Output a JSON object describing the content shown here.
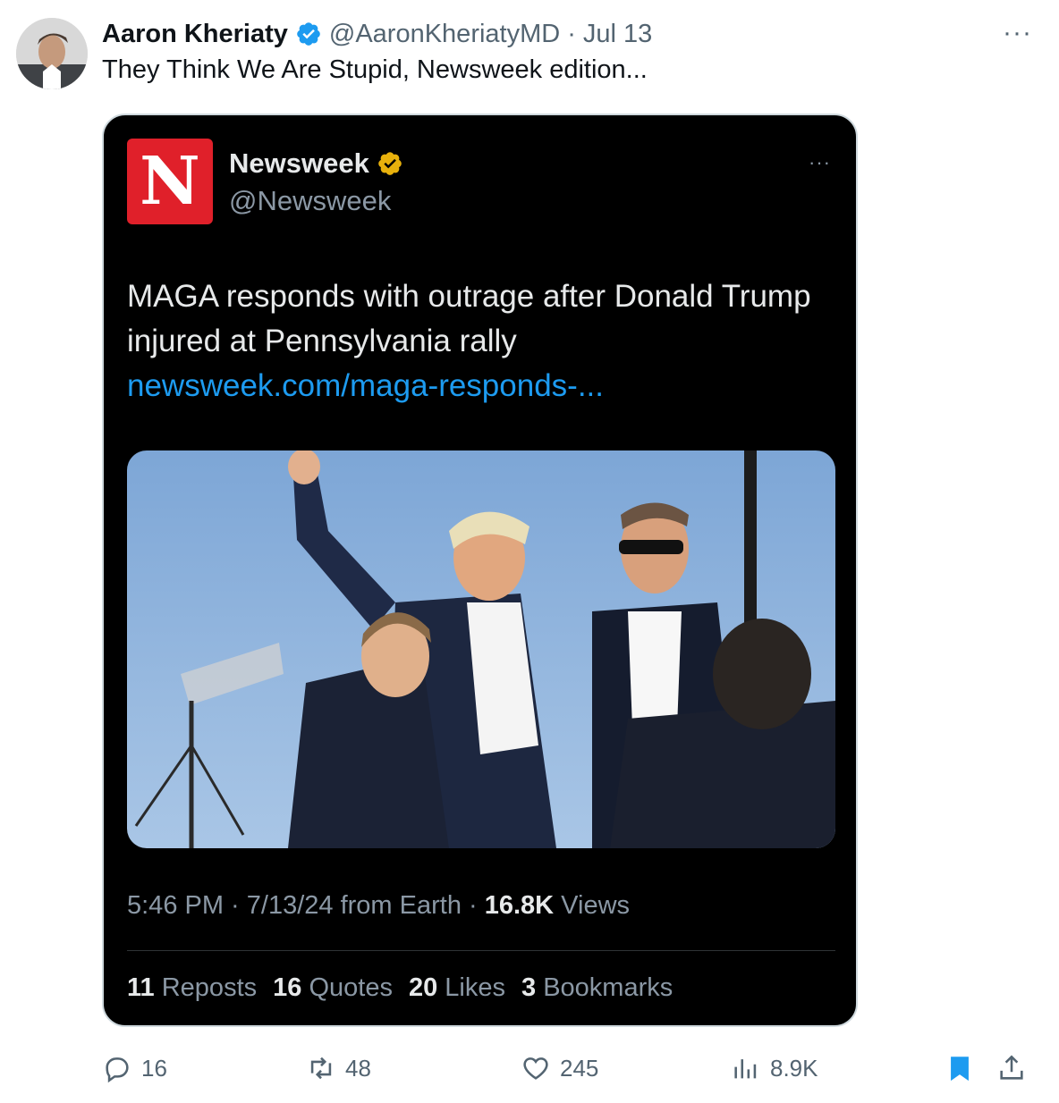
{
  "author": {
    "display_name": "Aaron Kheriaty",
    "handle": "@AaronKheriatyMD",
    "separator": "·",
    "date": "Jul 13",
    "text": "They Think We Are Stupid, Newsweek edition...",
    "more_icon": "···"
  },
  "embedded": {
    "logo_letter": "N",
    "display_name": "Newsweek",
    "handle": "@Newsweek",
    "more_icon": "···",
    "text": "MAGA responds with outrage after Donald Trump injured at Pennsylvania rally",
    "link": "newsweek.com/maga-responds-...",
    "meta_prefix": "5:46 PM · 7/13/24 from Earth · ",
    "views_count": "16.8K",
    "views_label": " Views",
    "stats": {
      "reposts_count": "11",
      "reposts_label": "Reposts",
      "quotes_count": "16",
      "quotes_label": "Quotes",
      "likes_count": "20",
      "likes_label": "Likes",
      "bookmarks_count": "3",
      "bookmarks_label": "Bookmarks"
    }
  },
  "actions": {
    "replies": "16",
    "reposts": "48",
    "likes": "245",
    "views": "8.9K"
  },
  "colors": {
    "accent": "#1d9bf0",
    "newsweek_red": "#e0202a",
    "gold_badge": "#e8b10c",
    "muted": "#536471"
  }
}
